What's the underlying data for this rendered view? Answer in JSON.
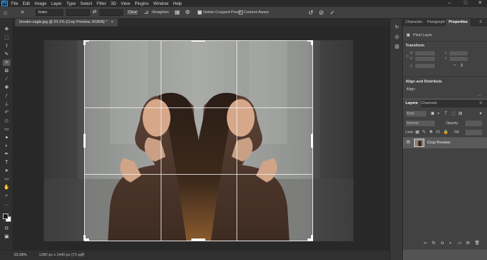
{
  "app": {
    "logo": "Ps"
  },
  "menu": [
    "File",
    "Edit",
    "Image",
    "Layer",
    "Type",
    "Select",
    "Filter",
    "3D",
    "View",
    "Plugins",
    "Window",
    "Help"
  ],
  "window_controls": {
    "minimize": "–",
    "maximize": "□",
    "close": "✕"
  },
  "options_bar": {
    "ratio_value": "Ratio",
    "clear_label": "Clear",
    "straighten_label": "Straighten",
    "delete_cropped_label": "Delete Cropped Pixels",
    "delete_cropped_checked": true,
    "content_aware_label": "Content-Aware",
    "content_aware_checked": false
  },
  "document": {
    "tab_title": "brooke-cagle.jpg @ 23.1% (Crop Preview, RGB/8) *",
    "tab_close": "×"
  },
  "status": {
    "zoom": "23.08%",
    "doc_info": "1280 px x 1440 px (72 ppi)",
    "arrow": ">"
  },
  "panels": {
    "top_tabs": [
      "Character",
      "Paragraph",
      "Properties"
    ],
    "active_top_tab": "Properties",
    "pixel_layer_label": "Pixel Layer",
    "transform_label": "Transform",
    "align_label": "Align and Distribute",
    "align_sub": "Align:",
    "more": "...",
    "layers_tabs": [
      "Layers",
      "Channels"
    ],
    "kind_label": "Kind",
    "blend_mode": "Normal",
    "opacity_label": "Opacity:",
    "lock_label": "Lock:",
    "fill_label": "Fill:",
    "layer_name": "Crop Preview"
  },
  "colors": {
    "app_bg": "#535353",
    "menubar": "#2b2b2b",
    "canvas_bg": "#282828",
    "panel_bg": "#424242",
    "accent": "#31a8ff"
  }
}
